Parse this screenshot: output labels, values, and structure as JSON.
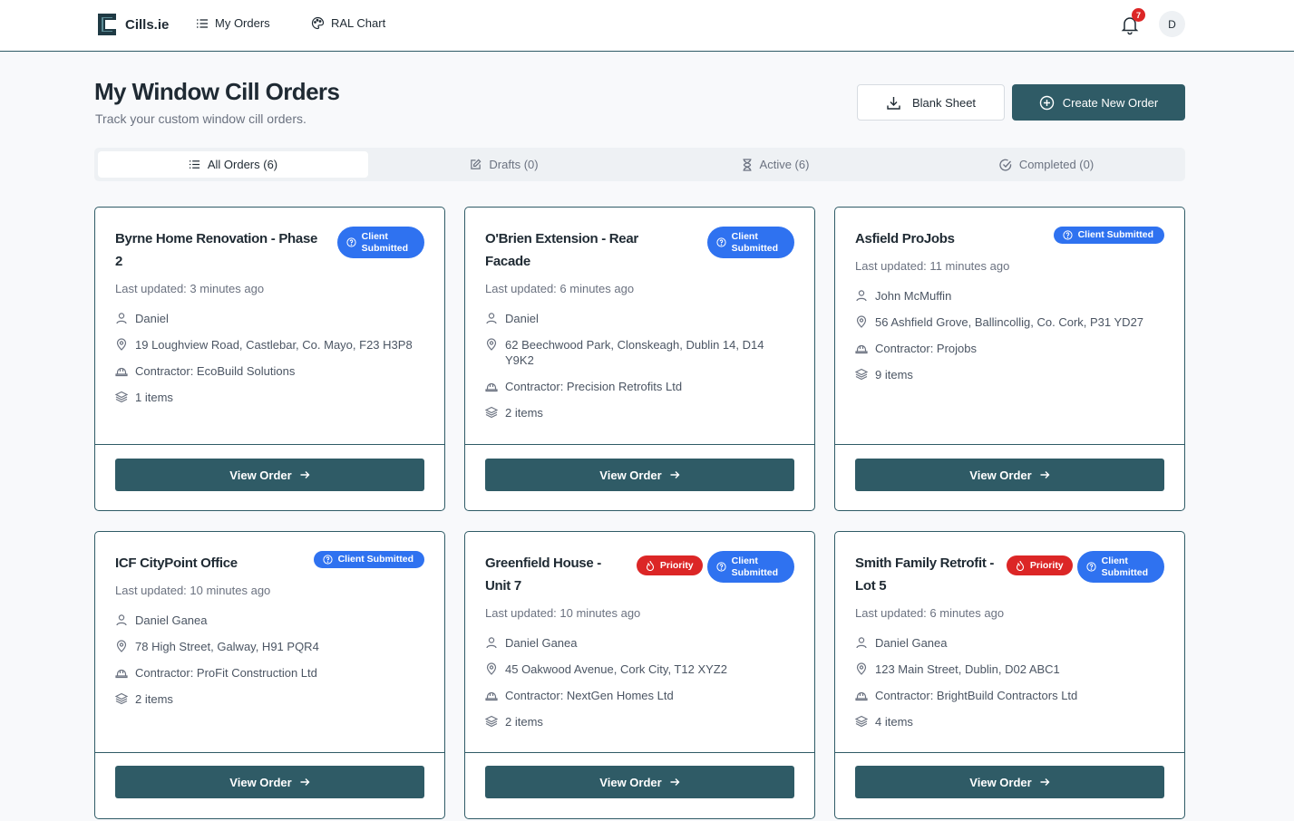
{
  "colors": {
    "primary": "#2f5b66",
    "badge_blue": "#2f72f0",
    "priority_red": "#dc2626"
  },
  "nav": {
    "brand": "Cills.ie",
    "links": [
      {
        "label": "My Orders",
        "icon": "list-icon"
      },
      {
        "label": "RAL Chart",
        "icon": "palette-icon"
      }
    ],
    "notifications_count": "7",
    "avatar_initial": "D"
  },
  "header": {
    "title": "My Window Cill Orders",
    "subtitle": "Track your custom window cill orders.",
    "blank_sheet_label": "Blank Sheet",
    "create_label": "Create New Order"
  },
  "tabs": [
    {
      "label": "All Orders (6)",
      "icon": "list-icon",
      "active": true
    },
    {
      "label": "Drafts (0)",
      "icon": "edit-icon",
      "active": false
    },
    {
      "label": "Active (6)",
      "icon": "hourglass-icon",
      "active": false
    },
    {
      "label": "Completed (0)",
      "icon": "check-circle-icon",
      "active": false
    }
  ],
  "orders": [
    {
      "title_lines": [
        "Byrne Home Renovation - Phase",
        "2"
      ],
      "badges": [
        {
          "label_lines": [
            "Client",
            "Submitted"
          ],
          "type": "status"
        }
      ],
      "updated": "Last updated: 3 minutes ago",
      "customer": "Daniel",
      "address_lines": [
        "19 Loughview Road, Castlebar, Co. Mayo, F23 H3P8"
      ],
      "contractor": "Contractor: EcoBuild Solutions",
      "items": "1 items",
      "view_label": "View Order"
    },
    {
      "title_lines": [
        "O'Brien Extension - Rear",
        "Facade"
      ],
      "badges": [
        {
          "label_lines": [
            "Client",
            "Submitted"
          ],
          "type": "status"
        }
      ],
      "updated": "Last updated: 6 minutes ago",
      "customer": "Daniel",
      "address_lines": [
        "62 Beechwood Park, Clonskeagh, Dublin 14, D14",
        "Y9K2"
      ],
      "contractor": "Contractor: Precision Retrofits Ltd",
      "items": "2 items",
      "view_label": "View Order"
    },
    {
      "title_lines": [
        "Asfield ProJobs"
      ],
      "badges": [
        {
          "label_lines": [
            "Client Submitted"
          ],
          "type": "status"
        }
      ],
      "updated": "Last updated: 11 minutes ago",
      "customer": "John McMuffin",
      "address_lines": [
        "56 Ashfield Grove, Ballincollig, Co. Cork, P31 YD27"
      ],
      "contractor": "Contractor: Projobs",
      "items": "9 items",
      "view_label": "View Order"
    },
    {
      "title_lines": [
        "ICF CityPoint Office"
      ],
      "badges": [
        {
          "label_lines": [
            "Client Submitted"
          ],
          "type": "status"
        }
      ],
      "updated": "Last updated: 10 minutes ago",
      "customer": "Daniel Ganea",
      "address_lines": [
        "78 High Street, Galway, H91 PQR4"
      ],
      "contractor": "Contractor: ProFit Construction Ltd",
      "items": "2 items",
      "view_label": "View Order"
    },
    {
      "title_lines": [
        "Greenfield House -",
        "Unit 7"
      ],
      "badges": [
        {
          "label_lines": [
            "Priority"
          ],
          "type": "priority"
        },
        {
          "label_lines": [
            "Client",
            "Submitted"
          ],
          "type": "status"
        }
      ],
      "updated": "Last updated: 10 minutes ago",
      "customer": "Daniel Ganea",
      "address_lines": [
        "45 Oakwood Avenue, Cork City, T12 XYZ2"
      ],
      "contractor": "Contractor: NextGen Homes Ltd",
      "items": "2 items",
      "view_label": "View Order"
    },
    {
      "title_lines": [
        "Smith Family Retrofit -",
        "Lot 5"
      ],
      "badges": [
        {
          "label_lines": [
            "Priority"
          ],
          "type": "priority"
        },
        {
          "label_lines": [
            "Client",
            "Submitted"
          ],
          "type": "status"
        }
      ],
      "updated": "Last updated: 6 minutes ago",
      "customer": "Daniel Ganea",
      "address_lines": [
        "123 Main Street, Dublin, D02 ABC1"
      ],
      "contractor": "Contractor: BrightBuild Contractors Ltd",
      "items": "4 items",
      "view_label": "View Order"
    }
  ]
}
